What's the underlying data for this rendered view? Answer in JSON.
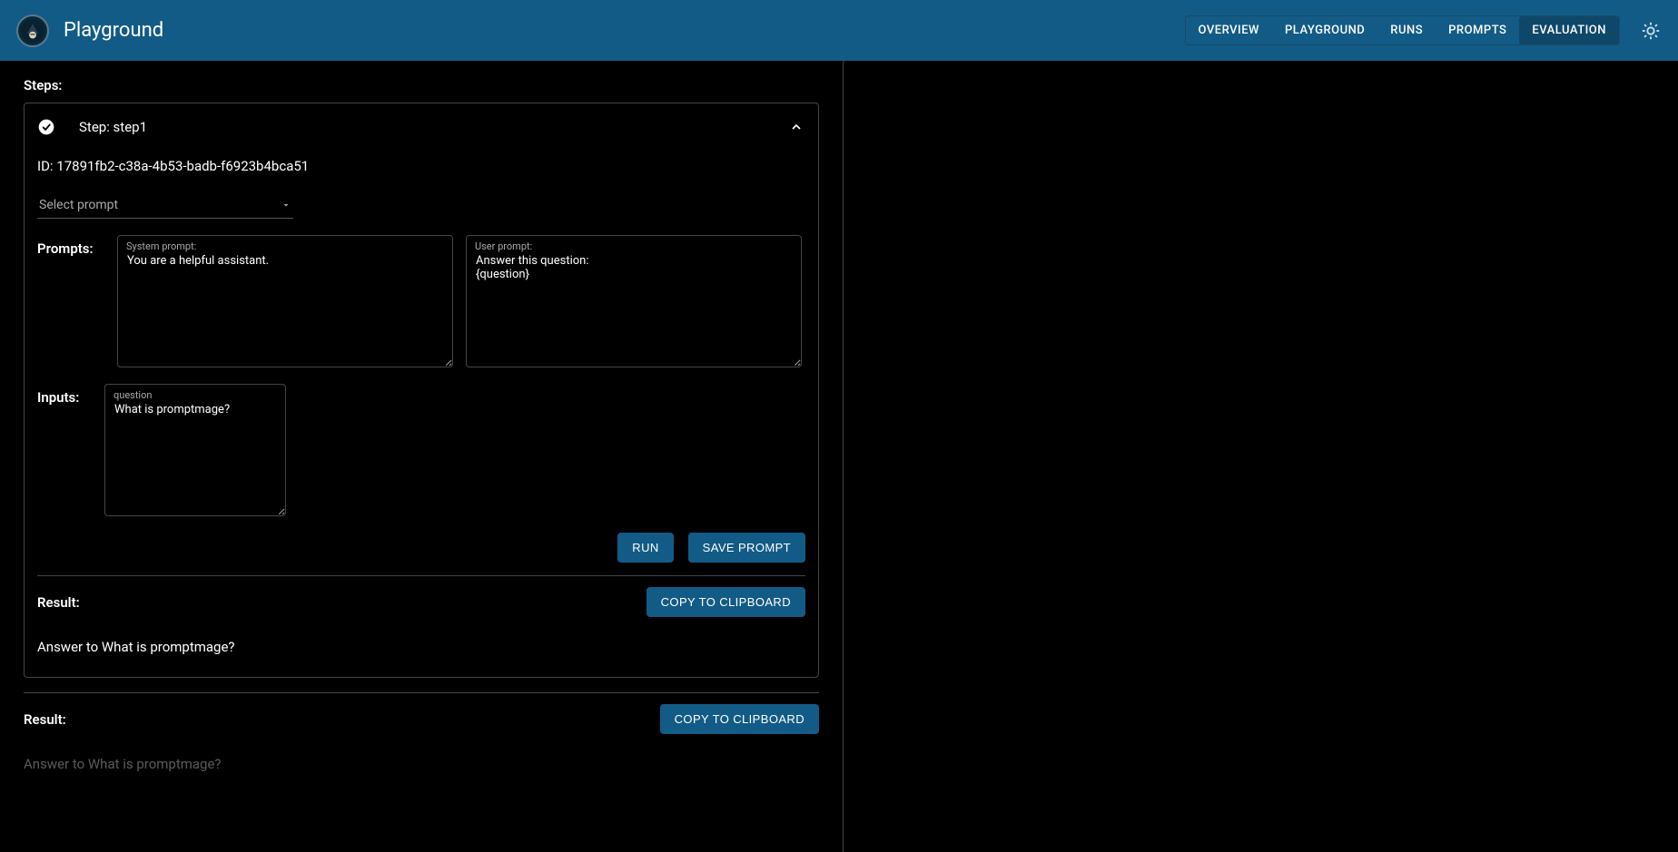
{
  "header": {
    "title": "Playground",
    "nav": [
      {
        "label": "OVERVIEW",
        "active": false
      },
      {
        "label": "PLAYGROUND",
        "active": false
      },
      {
        "label": "RUNS",
        "active": false
      },
      {
        "label": "PROMPTS",
        "active": false
      },
      {
        "label": "EVALUATION",
        "active": true
      }
    ]
  },
  "steps_label": "Steps:",
  "step": {
    "title": "Step: step1",
    "id_label": "ID: 17891fb2-c38a-4b53-badb-f6923b4bca51",
    "select_prompt_placeholder": "Select prompt",
    "prompts_label": "Prompts:",
    "system_prompt_label": "System prompt:",
    "system_prompt_value": "You are a helpful assistant.",
    "user_prompt_label": "User prompt:",
    "user_prompt_value": "Answer this question:\n{question}",
    "inputs_label": "Inputs:",
    "input_name": "question",
    "input_value": "What is promptmage?",
    "run_label": "RUN",
    "save_prompt_label": "SAVE PROMPT",
    "result_label": "Result:",
    "copy_label": "COPY TO CLIPBOARD",
    "result_text": "Answer to What is promptmage?"
  },
  "outer_result": {
    "label": "Result:",
    "copy_label": "COPY TO CLIPBOARD",
    "text": "Answer to What is promptmage?"
  }
}
